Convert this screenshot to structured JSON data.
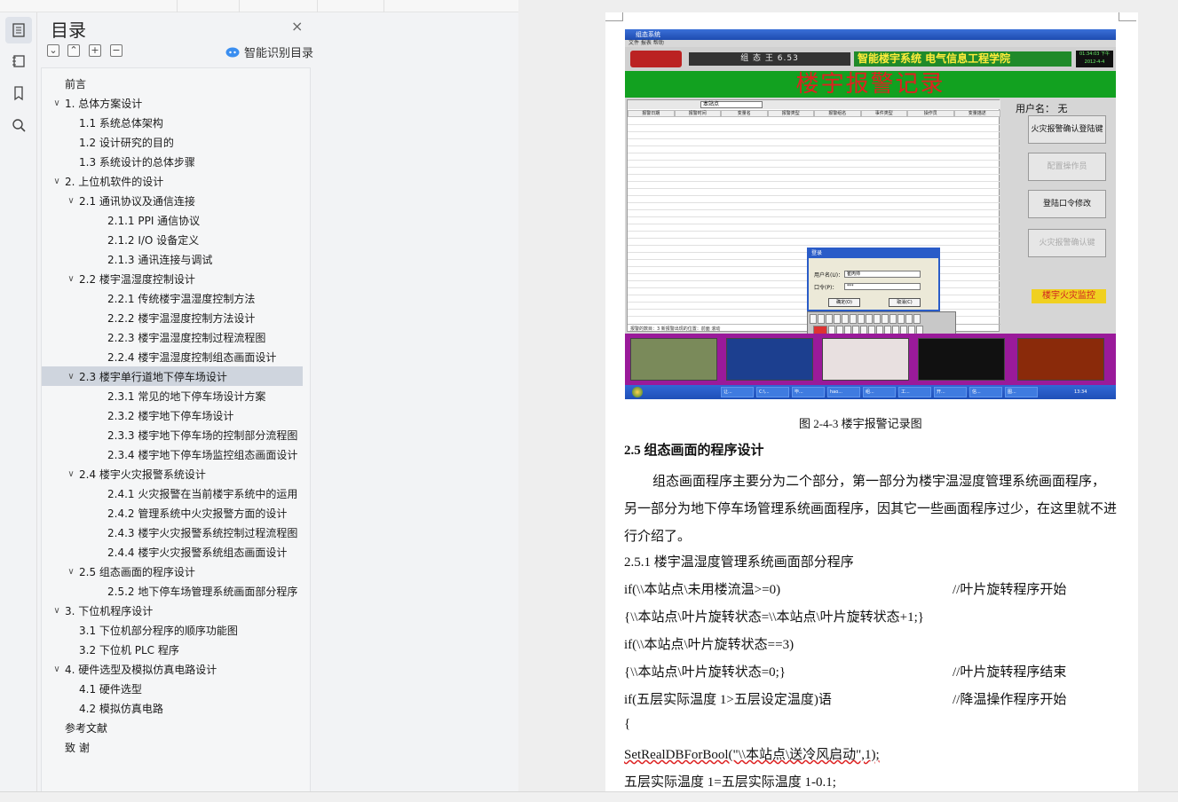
{
  "toc": {
    "title": "目录",
    "close_label": "×",
    "tools": [
      "⌄",
      "⌃",
      "+",
      "−"
    ],
    "smart_label": "智能识别目录",
    "items": [
      {
        "label": "前言",
        "level": 1,
        "expander": false
      },
      {
        "label": "1. 总体方案设计",
        "level": 1,
        "expander": true
      },
      {
        "label": "1.1  系统总体架构",
        "level": 2,
        "expander": false
      },
      {
        "label": "1.2  设计研究的目的",
        "level": 2,
        "expander": false
      },
      {
        "label": "1.3  系统设计的总体步骤",
        "level": 2,
        "expander": false
      },
      {
        "label": "2. 上位机软件的设计",
        "level": 1,
        "expander": true
      },
      {
        "label": "2.1  通讯协议及通信连接",
        "level": 2,
        "expander": true
      },
      {
        "label": "2.1.1 PPI 通信协议",
        "level": 3,
        "expander": false
      },
      {
        "label": "2.1.2 I/O 设备定义",
        "level": 3,
        "expander": false
      },
      {
        "label": "2.1.3  通讯连接与调试",
        "level": 3,
        "expander": false
      },
      {
        "label": "2.2  楼宇温湿度控制设计",
        "level": 2,
        "expander": true
      },
      {
        "label": "2.2.1  传统楼宇温湿度控制方法",
        "level": 3,
        "expander": false
      },
      {
        "label": "2.2.2  楼宇温湿度控制方法设计",
        "level": 3,
        "expander": false
      },
      {
        "label": "2.2.3  楼宇温湿度控制过程流程图",
        "level": 3,
        "expander": false
      },
      {
        "label": "2.2.4  楼宇温湿度控制组态画面设计",
        "level": 3,
        "expander": false
      },
      {
        "label": "2.3  楼宇单行道地下停车场设计",
        "level": 2,
        "expander": true,
        "selected": true
      },
      {
        "label": "2.3.1  常见的地下停车场设计方案",
        "level": 3,
        "expander": false
      },
      {
        "label": "2.3.2  楼宇地下停车场设计",
        "level": 3,
        "expander": false
      },
      {
        "label": "2.3.3  楼宇地下停车场的控制部分流程图",
        "level": 3,
        "expander": false
      },
      {
        "label": "2.3.4  楼宇地下停车场监控组态画面设计",
        "level": 3,
        "expander": false
      },
      {
        "label": "2.4  楼宇火灾报警系统设计",
        "level": 2,
        "expander": true
      },
      {
        "label": "2.4.1  火灾报警在当前楼宇系统中的运用",
        "level": 3,
        "expander": false
      },
      {
        "label": "2.4.2  管理系统中火灾报警方面的设计",
        "level": 3,
        "expander": false
      },
      {
        "label": "2.4.3  楼宇火灾报警系统控制过程流程图",
        "level": 3,
        "expander": false
      },
      {
        "label": "2.4.4  楼宇火灾报警系统组态画面设计",
        "level": 3,
        "expander": false
      },
      {
        "label": "2.5  组态画面的程序设计",
        "level": 2,
        "expander": true
      },
      {
        "label": "2.5.2  地下停车场管理系统画面部分程序",
        "level": 3,
        "expander": false
      },
      {
        "label": "3. 下位机程序设计",
        "level": 1,
        "expander": true
      },
      {
        "label": "3.1  下位机部分程序的顺序功能图",
        "level": 2,
        "expander": false
      },
      {
        "label": "3.2  下位机 PLC 程序",
        "level": 2,
        "expander": false
      },
      {
        "label": "4. 硬件选型及模拟仿真电路设计",
        "level": 1,
        "expander": true
      },
      {
        "label": "4.1  硬件选型",
        "level": 2,
        "expander": false
      },
      {
        "label": "4.2  模拟仿真电路",
        "level": 2,
        "expander": false
      },
      {
        "label": "参考文献",
        "level": 1,
        "expander": false
      },
      {
        "label": "致  谢",
        "level": 1,
        "expander": false
      }
    ]
  },
  "figure": {
    "window_title": "组态系统",
    "menu": "文件   报表   帮助",
    "banner_product": "组 态 王  6.53",
    "banner_green": "智能楼宇系统  电气信息工程学院",
    "banner_clock": "01:34:03 下午 2012-4-4",
    "headline": "楼宇报警记录",
    "grid_tool_text": "本站点",
    "grid_columns": [
      "报警日期",
      "报警时间",
      "变量名",
      "报警类型",
      "报警组名",
      "事件类型",
      "操作员",
      "变量描述"
    ],
    "grid_status": "报警的数目：3              新报警出现的位置：前面              滚动",
    "user_label": "用户名：     无",
    "side_buttons": [
      "火灾报警确认登陆键",
      "配置操作员",
      "登陆口令修改",
      "火灾报警确认键"
    ],
    "side_link": "楼宇火灾监控",
    "login": {
      "title": "登录",
      "user_label": "用户名(U)：",
      "user_value": "崔丙帅",
      "pass_label": "口令(P)：",
      "pass_value": "***",
      "ok": "确定(O)",
      "cancel": "取消(C)"
    },
    "taskbar_items": [
      "让...",
      "C:\\...",
      "毕...",
      "hao...",
      "组...",
      "工...",
      "开...",
      "信...",
      "图..."
    ],
    "tray_time": "13:34"
  },
  "doc": {
    "caption": "图 2-4-3    楼宇报警记录图",
    "section_title": "2.5  组态画面的程序设计",
    "para1": "组态画面程序主要分为二个部分，第一部分为楼宇温湿度管理系统画面程序，另一部分为地下停车场管理系统画面程序，因其它一些画面程序过少，在这里就不进行介绍了。",
    "sub_title": "2.5.1  楼宇温湿度管理系统画面部分程序",
    "code": [
      {
        "text": "if(\\\\本站点\\未用楼流温>=0)",
        "comment": "//叶片旋转程序开始"
      },
      {
        "text": "{\\\\本站点\\叶片旋转状态=\\\\本站点\\叶片旋转状态+1;}",
        "comment": ""
      },
      {
        "text": "if(\\\\本站点\\叶片旋转状态==3)",
        "comment": ""
      },
      {
        "text": "{\\\\本站点\\叶片旋转状态=0;}",
        "comment": "//叶片旋转程序结束"
      },
      {
        "text": "if(五层实际温度 1>五层设定温度)语",
        "comment": "//降温操作程序开始"
      },
      {
        "text": "{",
        "comment": ""
      },
      {
        "text": "SetRealDBForBool(\"\\\\本站点\\送冷风启动\",1);",
        "comment": ""
      },
      {
        "text": "五层实际温度 1=五层实际温度 1-0.1;",
        "comment": ""
      }
    ]
  }
}
